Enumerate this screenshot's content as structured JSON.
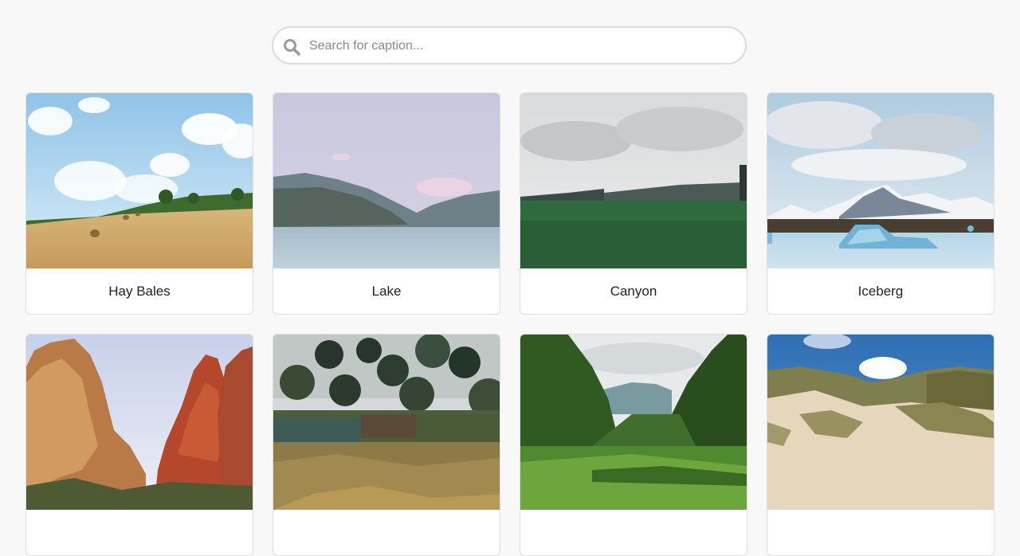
{
  "search": {
    "placeholder": "Search for caption...",
    "value": ""
  },
  "gallery": [
    {
      "caption": "Hay Bales",
      "image": "hay-bales-landscape"
    },
    {
      "caption": "Lake",
      "image": "lake-landscape"
    },
    {
      "caption": "Canyon",
      "image": "canyon-landscape"
    },
    {
      "caption": "Iceberg",
      "image": "iceberg-landscape"
    },
    {
      "caption": "",
      "image": "red-rock-canyon-landscape"
    },
    {
      "caption": "",
      "image": "garden-trees-landscape"
    },
    {
      "caption": "",
      "image": "green-valley-landscape"
    },
    {
      "caption": "",
      "image": "sand-dunes-landscape"
    }
  ]
}
